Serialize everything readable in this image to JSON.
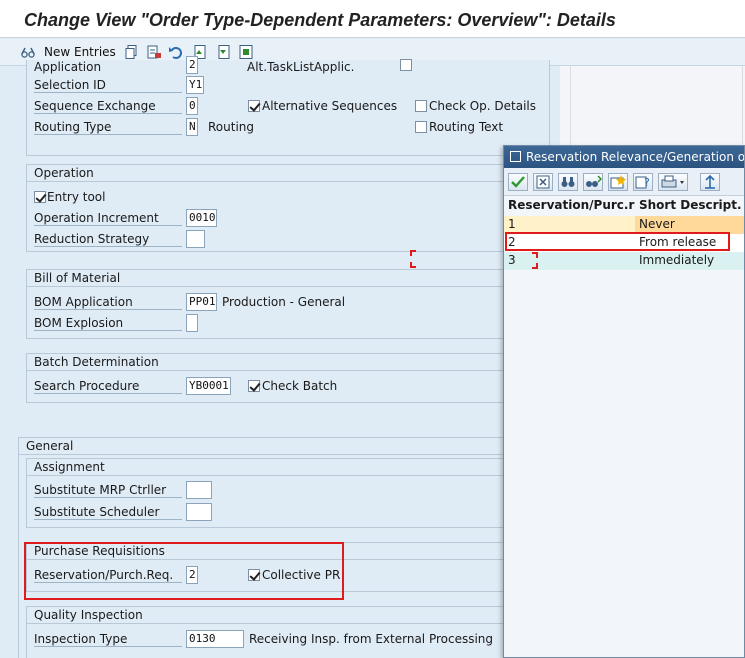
{
  "window": {
    "title": "Change View \"Order Type-Dependent Parameters: Overview\": Details"
  },
  "toolbar": {
    "new_entries_label": "New Entries"
  },
  "top_section": {
    "application_label": "Application",
    "application_value": "2",
    "alt_tasklist_label": "Alt.TaskListApplic.",
    "selection_id_label": "Selection ID",
    "selection_id_value": "Y1",
    "sequence_exchange_label": "Sequence Exchange",
    "sequence_exchange_value": "0",
    "alternative_sequences_label": "Alternative Sequences",
    "check_op_details_label": "Check Op. Details",
    "routing_type_label": "Routing Type",
    "routing_type_value": "N",
    "routing_type_text": "Routing",
    "routing_text_label": "Routing Text"
  },
  "operation": {
    "title": "Operation",
    "entry_tool_label": "Entry tool",
    "operation_increment_label": "Operation Increment",
    "operation_increment_value": "0010",
    "reduction_strategy_label": "Reduction Strategy"
  },
  "bom": {
    "title": "Bill of Material",
    "bom_application_label": "BOM Application",
    "bom_application_value": "PP01",
    "bom_application_text": "Production - General",
    "bom_explosion_label": "BOM Explosion"
  },
  "batch": {
    "title": "Batch Determination",
    "search_procedure_label": "Search Procedure",
    "search_procedure_value": "YB0001",
    "check_batch_label": "Check Batch"
  },
  "general": {
    "title": "General",
    "assignment": {
      "title": "Assignment",
      "substitute_mrp_label": "Substitute MRP Ctrller",
      "substitute_scheduler_label": "Substitute Scheduler"
    },
    "purchase_requisitions": {
      "title": "Purchase Requisitions",
      "reservation_label": "Reservation/Purch.Req.",
      "reservation_value": "2",
      "collective_pr_label": "Collective PR"
    },
    "quality_inspection": {
      "title": "Quality Inspection",
      "inspection_type_label": "Inspection Type",
      "inspection_type_value": "0130",
      "inspection_type_text": "Receiving Insp. from External Processing"
    }
  },
  "popup": {
    "title": "Reservation Relevance/Generation of Purc",
    "columns": [
      "Reservation/Purc.req",
      "Short Descript."
    ],
    "rows": [
      {
        "key": "1",
        "text": "Never"
      },
      {
        "key": "2",
        "text": "From release"
      },
      {
        "key": "3",
        "text": "Immediately"
      }
    ]
  },
  "colors": {
    "highlight_red": "#e01b1b",
    "row_never_bg": "#fff2c8",
    "row_immediately_bg": "#d9f1f1",
    "popup_title_bg": "#2b5380"
  }
}
